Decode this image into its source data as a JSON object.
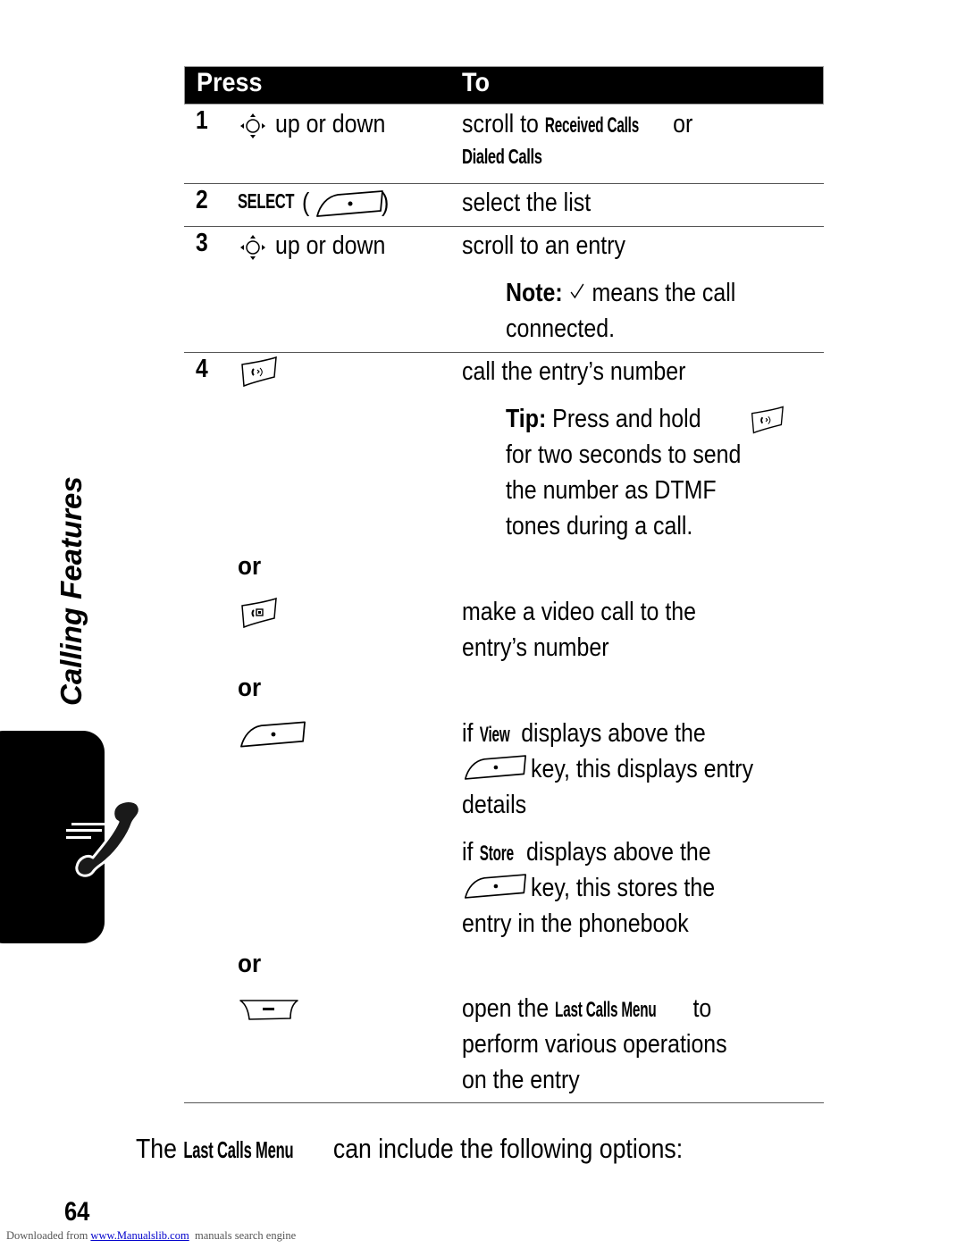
{
  "table": {
    "headers": {
      "press": "Press",
      "to": "To"
    },
    "rows": [
      {
        "number": "1",
        "press_icon": "nav-key-icon",
        "press_text": "up or down",
        "to_parts": {
          "pre": "scroll to ",
          "ui1": "Received Calls",
          "mid": " or",
          "ui2": "Dialed Calls"
        }
      },
      {
        "number": "2",
        "press_ui": "SELECT",
        "press_icon": "center-soft-key-icon",
        "press_paren_open": "(",
        "press_paren_close": ")",
        "to_text": "select the list"
      },
      {
        "number": "3",
        "press_icon": "nav-key-icon",
        "press_text": "up or down",
        "to_text": "scroll to an entry",
        "note": {
          "label": "Note:",
          "icon": "checkmark-icon",
          "line1": " means the call",
          "line2": "connected."
        }
      },
      {
        "number": "4",
        "press_icon": "send-key-icon",
        "to_text": "call the entry’s number",
        "tip": {
          "label": "Tip:",
          "line1": " Press and hold",
          "icon": "send-key-icon",
          "line2": "for two seconds to send",
          "line3": "the number as DTMF",
          "line4": "tones during a call."
        },
        "alternatives": [
          {
            "or_label": "or",
            "press_icon": "video-call-key-icon",
            "to_lines": [
              "make a video call to the",
              "entry’s number"
            ]
          },
          {
            "or_label": "or",
            "press_icon": "center-soft-key-icon",
            "paragraphs": [
              {
                "pre": "if ",
                "ui": "View",
                "post": " displays above the",
                "line2_post": " key, this displays entry",
                "line3": "details"
              },
              {
                "pre": "if ",
                "ui": "Store",
                "post": " displays above the",
                "line2_post": " key, this stores the",
                "line3": "entry in the phonebook"
              }
            ]
          },
          {
            "or_label": "or",
            "press_icon": "menu-key-icon",
            "to_parts": {
              "pre": "open the ",
              "ui": "Last Calls Menu",
              "post": " to",
              "line2": "perform various operations",
              "line3": "on the entry"
            }
          }
        ]
      }
    ]
  },
  "summary": {
    "pre": "The ",
    "ui": "Last Calls Menu",
    "post": " can include the following options:"
  },
  "sidebar": {
    "section_title": "Calling Features",
    "tab_icon": "calling-phone-icon"
  },
  "page_number": "64",
  "footer": {
    "pre": "Downloaded from ",
    "link": "www.Manualslib.com",
    "post": "  manuals search engine"
  }
}
